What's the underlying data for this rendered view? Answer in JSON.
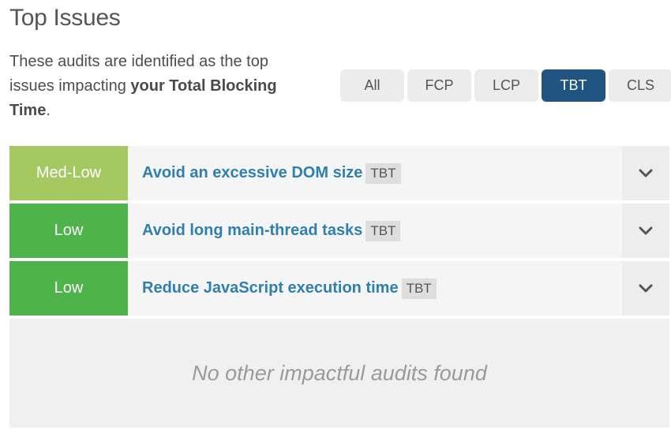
{
  "header": {
    "title": "Top Issues",
    "description_prefix": "These audits are identified as the top issues impacting ",
    "description_bold": "your Total Blocking Time",
    "description_suffix": "."
  },
  "filters": {
    "active": "TBT",
    "items": [
      {
        "label": "All"
      },
      {
        "label": "FCP"
      },
      {
        "label": "LCP"
      },
      {
        "label": "TBT"
      },
      {
        "label": "CLS"
      }
    ]
  },
  "colors": {
    "accent": "#1f5580",
    "med_low": "#a6c860",
    "low": "#4db34a",
    "link": "#2f7fb0"
  },
  "issues": [
    {
      "severity": "Med-Low",
      "severity_color": "#a6c860",
      "title": "Avoid an excessive DOM size",
      "tag": "TBT",
      "icon": "chevron-down-icon"
    },
    {
      "severity": "Low",
      "severity_color": "#4db34a",
      "title": "Avoid long main-thread tasks",
      "tag": "TBT",
      "icon": "chevron-down-icon"
    },
    {
      "severity": "Low",
      "severity_color": "#4db34a",
      "title": "Reduce JavaScript execution time",
      "tag": "TBT",
      "icon": "chevron-down-icon"
    }
  ],
  "empty_message": "No other impactful audits found"
}
